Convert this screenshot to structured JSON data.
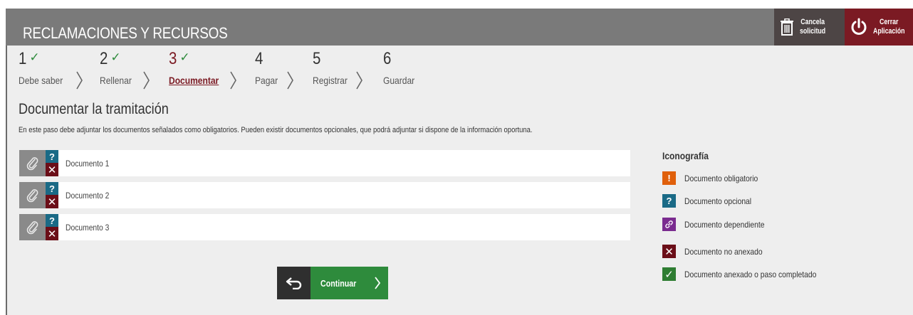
{
  "app": {
    "title": "RECLAMACIONES Y RECURSOS",
    "cancel_label_line1": "Cancela",
    "cancel_label_line2": "solicitud",
    "close_label_line1": "Cerrar",
    "close_label_line2": "Aplicación"
  },
  "steps": [
    {
      "num": "1",
      "name": "Debe saber",
      "completed": true,
      "active": false
    },
    {
      "num": "2",
      "name": "Rellenar",
      "completed": true,
      "active": false
    },
    {
      "num": "3",
      "name": "Documentar",
      "completed": true,
      "active": true
    },
    {
      "num": "4",
      "name": "Pagar",
      "completed": false,
      "active": false
    },
    {
      "num": "5",
      "name": "Registrar",
      "completed": false,
      "active": false
    },
    {
      "num": "6",
      "name": "Guardar",
      "completed": false,
      "active": false
    }
  ],
  "section": {
    "title": "Documentar la tramitación",
    "description": "En este paso debe adjuntar los documentos señalados como obligatorios. Pueden existir documentos opcionales, que podrá adjuntar si dispone de la información oportuna."
  },
  "documents": [
    {
      "name": "Documento 1",
      "status_icon": "question-icon",
      "attached_icon": "x-icon"
    },
    {
      "name": "Documento 2",
      "status_icon": "question-icon",
      "attached_icon": "x-icon"
    },
    {
      "name": "Documento 3",
      "status_icon": "question-icon",
      "attached_icon": "x-icon"
    }
  ],
  "actions": {
    "continue_label": "Continuar"
  },
  "legend": {
    "title": "Iconografía",
    "items": [
      {
        "label": "Documento obligatorio",
        "symbol": "!",
        "color": "#e0600b",
        "icon": "exclamation-icon"
      },
      {
        "label": "Documento opcional",
        "symbol": "?",
        "color": "#1a6a86",
        "icon": "question-icon"
      },
      {
        "label": "Documento dependiente",
        "symbol": "link",
        "color": "#7a2b8f",
        "icon": "link-icon"
      },
      {
        "label": "Documento no anexado",
        "symbol": "✕",
        "color": "#6b0e18",
        "icon": "x-icon"
      },
      {
        "label": "Documento anexado o paso completado",
        "symbol": "✓",
        "color": "#2e7d32",
        "icon": "check-icon"
      }
    ]
  },
  "colors": {
    "accent_dark_red": "#7b1a23",
    "check_green": "#2e8b3c",
    "header_gray": "#7a7a7a"
  }
}
